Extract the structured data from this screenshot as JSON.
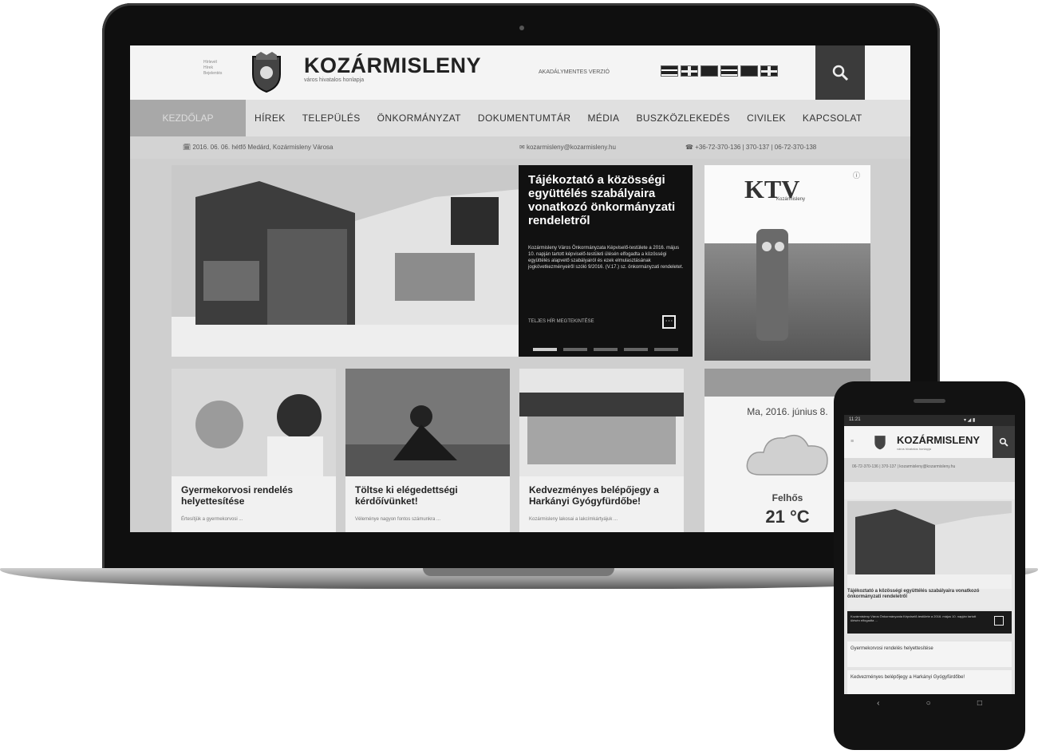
{
  "site": {
    "title": "KOZÁRMISLENY",
    "subtitle": "város hivatalos honlapja",
    "mini_menu": [
      "Hírlevél",
      "Hírek",
      "Bejelentés"
    ],
    "accessibility": "AKADÁLYMENTES VERZIÓ"
  },
  "nav": {
    "home": "KEZDŐLAP",
    "items": [
      "HÍREK",
      "TELEPÜLÉS",
      "ÖNKORMÁNYZAT",
      "DOKUMENTUMTÁR",
      "MÉDIA",
      "BUSZKÖZLEKEDÉS",
      "CIVILEK",
      "KAPCSOLAT"
    ]
  },
  "info_bar": {
    "date": "2016. 06. 06. hétfő Medárd, Kozármisleny Városa",
    "mail": "kozarmisleny@kozarmisleny.hu",
    "phone": "+36-72-370-136 | 370-137 | 06-72-370-138"
  },
  "hero": {
    "title": "Tájékoztató a közösségi együttélés szabályaira vonatkozó önkormányzati rendeletről",
    "text": "Kozármisleny Város Önkormányzata Képviselő-testülete a 2016. május 10. napján tartott képviselő-testületi ülésén elfogadta a közösségi együttélés alapvető szabályairól és ezek elmulasztásának jogkövetkezményeiről szóló 9/2016. (V.17.) sz. önkormányzati rendeletet.",
    "read_more": "TELJES HÍR MEGTEKINTÉSE",
    "more_icon": "⋯"
  },
  "ad": {
    "logo": "KTV",
    "caption": "Kozármisleny",
    "corner_icon": "ⓘ"
  },
  "news": [
    {
      "title": "Gyermekorvosi rendelés helyettesítése",
      "excerpt": "Értesítjük a gyermekorvosi ..."
    },
    {
      "title": "Töltse ki elégedettségi kérdőívünket!",
      "excerpt": "Véleménye nagyon fontos számunkra ..."
    },
    {
      "title": "Kedvezményes belépőjegy a Harkányi Gyógyfürdőbe!",
      "excerpt": "Kozármisleny lakosai a lakcímkártyájuk ..."
    }
  ],
  "weather": {
    "date": "Ma, 2016. június 8.",
    "description": "Felhős",
    "temperature": "21 °C"
  },
  "phone": {
    "status_time": "11:21",
    "status_icons": "▾ ◢ ▮",
    "info": "06-72-370-136 | 370-137 | kozarmisleny@kozarmisleny.hu",
    "hero_title": "Tájékoztató a közösségi együttélés szabályaira vonatkozó önkormányzati rendeletről",
    "hero_text": "Kozármisleny Város Önkormányzata Képviselő-testülete a 2016. május 10. napján tartott ülésén elfogadta ...",
    "news_1": "Gyermekorvosi rendelés helyettesítése",
    "news_2": "Kedvezményes belépőjegy a Harkányi Gyógyfürdőbe!",
    "nav": [
      "‹",
      "○",
      "□"
    ]
  }
}
